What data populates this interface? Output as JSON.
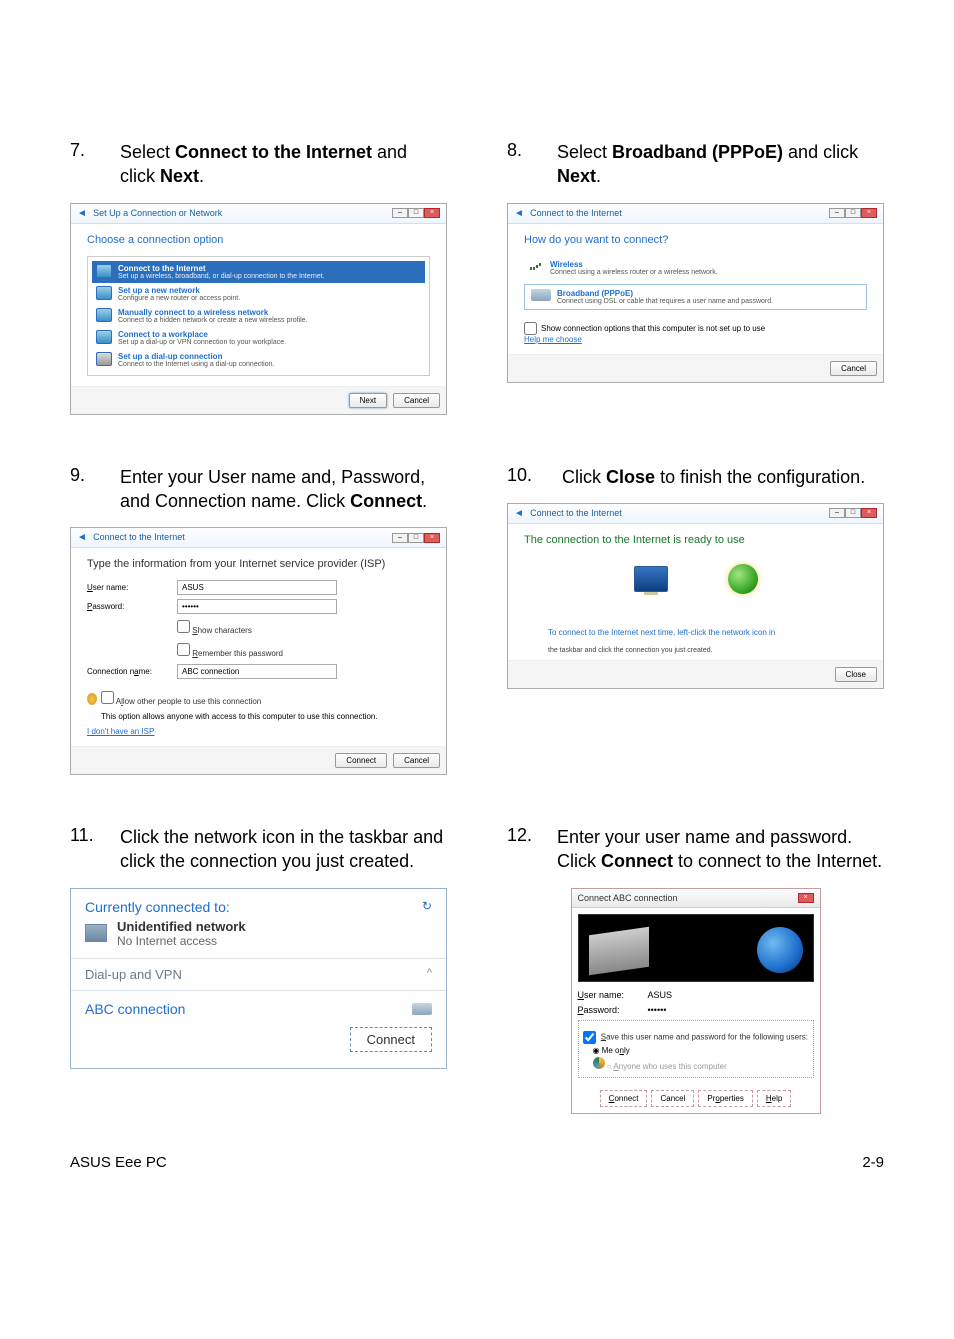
{
  "steps": {
    "s7": {
      "num": "7.",
      "prefix": "Select ",
      "bold1": "Connect to the Internet",
      "mid": " and click ",
      "bold2": "Next",
      "suffix": "."
    },
    "s8": {
      "num": "8.",
      "prefix": "Select ",
      "bold1": "Broadband (PPPoE)",
      "mid": " and click ",
      "bold2": "Next",
      "suffix": "."
    },
    "s9": {
      "num": "9.",
      "text": "Enter your User name and, Password, and Connection name. Click ",
      "bold": "Connect",
      "suffix": "."
    },
    "s10": {
      "num": "10.",
      "prefix": "Click ",
      "bold": "Close",
      "suffix": " to finish the configuration."
    },
    "s11": {
      "num": "11.",
      "text": "Click the network icon in the taskbar and click the connection you just created."
    },
    "s12": {
      "num": "12.",
      "prefix": "Enter your user name and password. Click ",
      "bold": "Connect",
      "suffix": " to connect to the Internet."
    }
  },
  "ss7": {
    "header": "Set Up a Connection or Network",
    "title": "Choose a connection option",
    "opts": [
      {
        "title": "Connect to the Internet",
        "desc": "Set up a wireless, broadband, or dial-up connection to the Internet."
      },
      {
        "title": "Set up a new network",
        "desc": "Configure a new router or access point."
      },
      {
        "title": "Manually connect to a wireless network",
        "desc": "Connect to a hidden network or create a new wireless profile."
      },
      {
        "title": "Connect to a workplace",
        "desc": "Set up a dial-up or VPN connection to your workplace."
      },
      {
        "title": "Set up a dial-up connection",
        "desc": "Connect to the Internet using a dial-up connection."
      }
    ],
    "next": "Next",
    "cancel": "Cancel"
  },
  "ss8": {
    "header": "Connect to the Internet",
    "title": "How do you want to connect?",
    "wireless_title": "Wireless",
    "wireless_desc": "Connect using a wireless router or a wireless network.",
    "bb_title": "Broadband (PPPoE)",
    "bb_desc": "Connect using DSL or cable that requires a user name and password.",
    "showopts": "Show connection options that this computer is not set up to use",
    "help": "Help me choose",
    "cancel": "Cancel"
  },
  "ss9": {
    "header": "Connect to the Internet",
    "title": "Type the information from your Internet service provider (ISP)",
    "user_label": "User name:",
    "user_value": "ASUS",
    "pwd_label": "Password:",
    "pwd_value": "••••••",
    "show_chars": "Show characters",
    "remember": "Remember this password",
    "connname_label": "Connection name:",
    "connname_value": "ABC connection",
    "allow_others": "Allow other people to use this connection",
    "allow_desc": "This option allows anyone with access to this computer to use this connection.",
    "no_isp": "I don't have an ISP",
    "connect": "Connect",
    "cancel": "Cancel"
  },
  "ss10": {
    "header": "Connect to the Internet",
    "title": "The connection to the Internet is ready to use",
    "hint": "To connect to the Internet next time, left-click the network icon in",
    "hint2": "the taskbar and click the connection you just created.",
    "close": "Close"
  },
  "ss11": {
    "connected_to": "Currently connected to:",
    "net_name": "Unidentified network",
    "net_sub": "No Internet access",
    "category": "Dial-up and VPN",
    "conn_name": "ABC connection",
    "connect": "Connect"
  },
  "ss12": {
    "title": "Connect ABC connection",
    "user_label": "User name:",
    "user_value": "ASUS",
    "pwd_label": "Password:",
    "pwd_value": "••••••",
    "save_check": "Save this user name and password for the following users:",
    "radio_me": "Me only",
    "radio_anyone": "Anyone who uses this computer",
    "connect": "Connect",
    "cancel": "Cancel",
    "properties": "Properties",
    "help": "Help"
  },
  "footer": {
    "left": "ASUS Eee PC",
    "right": "2-9"
  }
}
